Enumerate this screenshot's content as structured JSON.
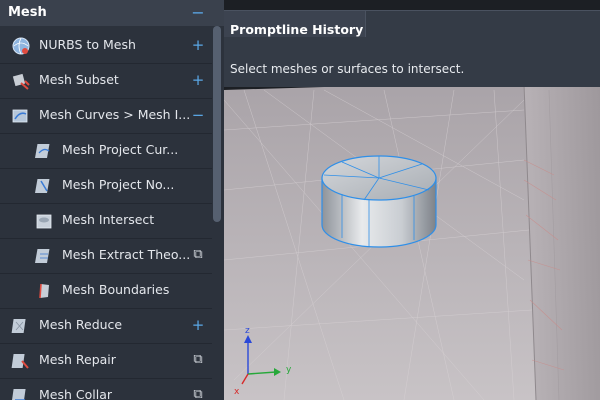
{
  "sidebar": {
    "title": "Mesh",
    "collapse_glyph": "−",
    "items": [
      {
        "label": "NURBS to Mesh",
        "icon": "nurbs-to-mesh-icon",
        "action_glyph": "+"
      },
      {
        "label": "Mesh Subset",
        "icon": "mesh-subset-icon",
        "action_glyph": "+"
      },
      {
        "label": "Mesh Curves > Mesh I...",
        "icon": "mesh-curves-icon",
        "action_glyph": "−"
      },
      {
        "label": "Mesh Project Cur...",
        "icon": "mesh-project-curve-icon"
      },
      {
        "label": "Mesh Project No...",
        "icon": "mesh-project-normal-icon"
      },
      {
        "label": "Mesh Intersect",
        "icon": "mesh-intersect-icon"
      },
      {
        "label": "Mesh Extract Theo...",
        "icon": "mesh-extract-theoretical-icon",
        "action_glyph": "⧉"
      },
      {
        "label": "Mesh Boundaries",
        "icon": "mesh-boundaries-icon"
      },
      {
        "label": "Mesh Reduce",
        "icon": "mesh-reduce-icon",
        "action_glyph": "+"
      },
      {
        "label": "Mesh Repair",
        "icon": "mesh-repair-icon",
        "action_glyph": "⧉"
      },
      {
        "label": "Mesh Collar",
        "icon": "mesh-collar-icon",
        "action_glyph": "⧉"
      }
    ]
  },
  "promptline": {
    "title": "Promptline History",
    "message": "Select meshes or surfaces to intersect."
  },
  "viewport": {
    "axes": {
      "x": "x",
      "y": "y",
      "z": "z"
    }
  },
  "colors": {
    "accent": "#5aa7e6",
    "panel": "#2c323c",
    "selection": "#2f8fe8"
  }
}
